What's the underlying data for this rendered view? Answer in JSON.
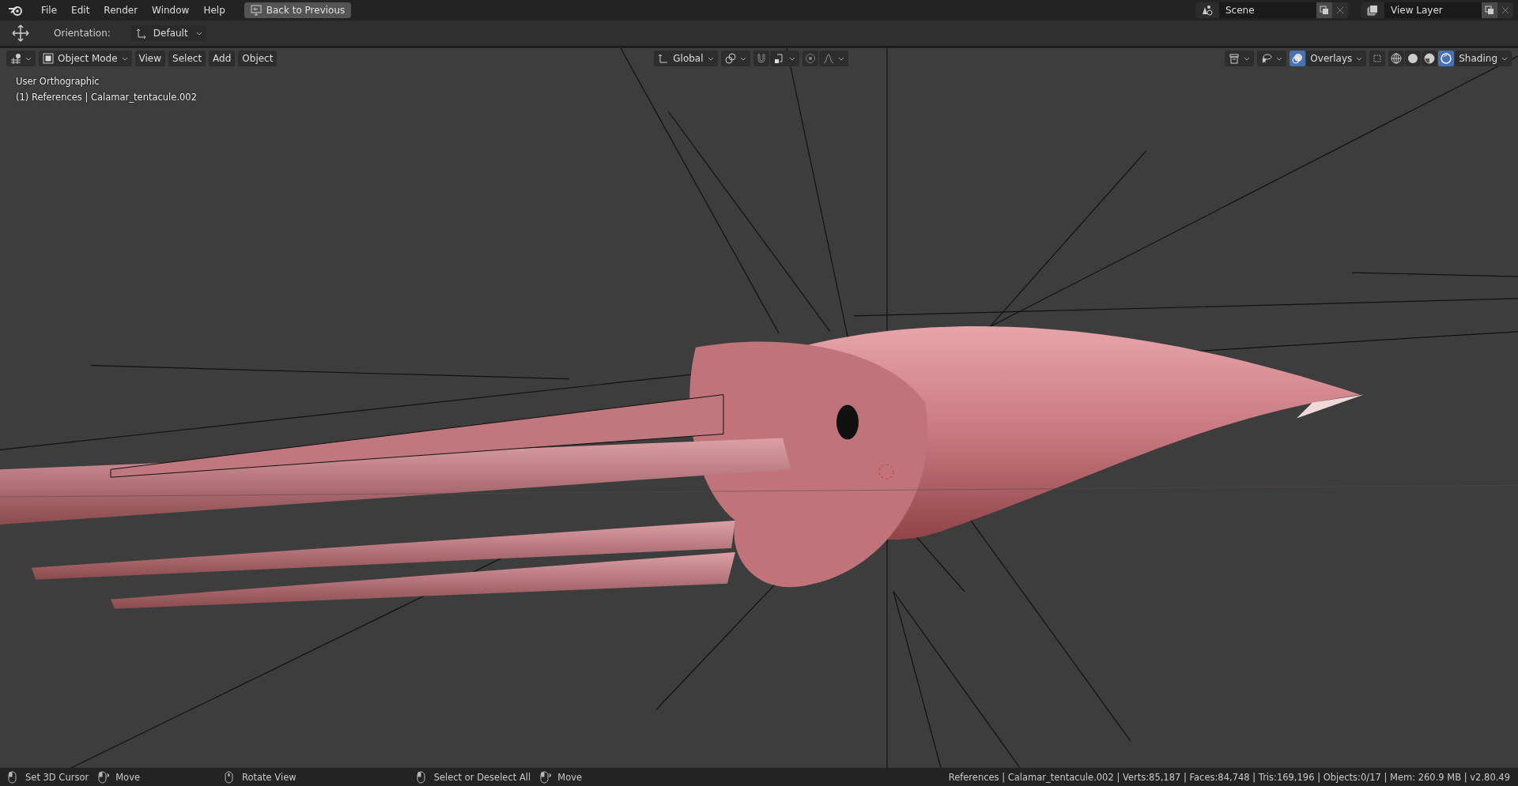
{
  "top_bar": {
    "menus": [
      "File",
      "Edit",
      "Render",
      "Window",
      "Help"
    ],
    "back_button": "Back to Previous",
    "scene": "Scene",
    "view_layer": "View Layer"
  },
  "tool_settings": {
    "orientation_label": "Orientation:",
    "orientation_value": "Default"
  },
  "viewport_header": {
    "mode": "Object Mode",
    "menus": [
      "View",
      "Select",
      "Add",
      "Object"
    ],
    "transform_orientation": "Global",
    "overlays": {
      "label": "Overlays",
      "on": true
    },
    "shading": {
      "label": "Shading",
      "modes": [
        {
          "kind": "wireframe",
          "selected": false
        },
        {
          "kind": "solid",
          "selected": false
        },
        {
          "kind": "material",
          "selected": false
        },
        {
          "kind": "rendered",
          "selected": true
        }
      ]
    }
  },
  "viewport_info": [
    "User Orthographic",
    "(1) References | Calamar_tentacule.002"
  ],
  "status_bar": {
    "hints": [
      {
        "kind": "left",
        "label": "Set 3D Cursor"
      },
      {
        "kind": "left-drag",
        "label": "Move"
      },
      {
        "kind": "middle",
        "label": "Rotate View"
      },
      {
        "kind": "left",
        "label": "Select or Deselect All"
      },
      {
        "kind": "left-drag",
        "label": "Move"
      }
    ],
    "stats": "References | Calamar_tentacule.002 | Verts:85,187 | Faces:84,748 | Tris:169,196 | Objects:0/17 | Mem: 260.9 MB | v2.80.49"
  }
}
